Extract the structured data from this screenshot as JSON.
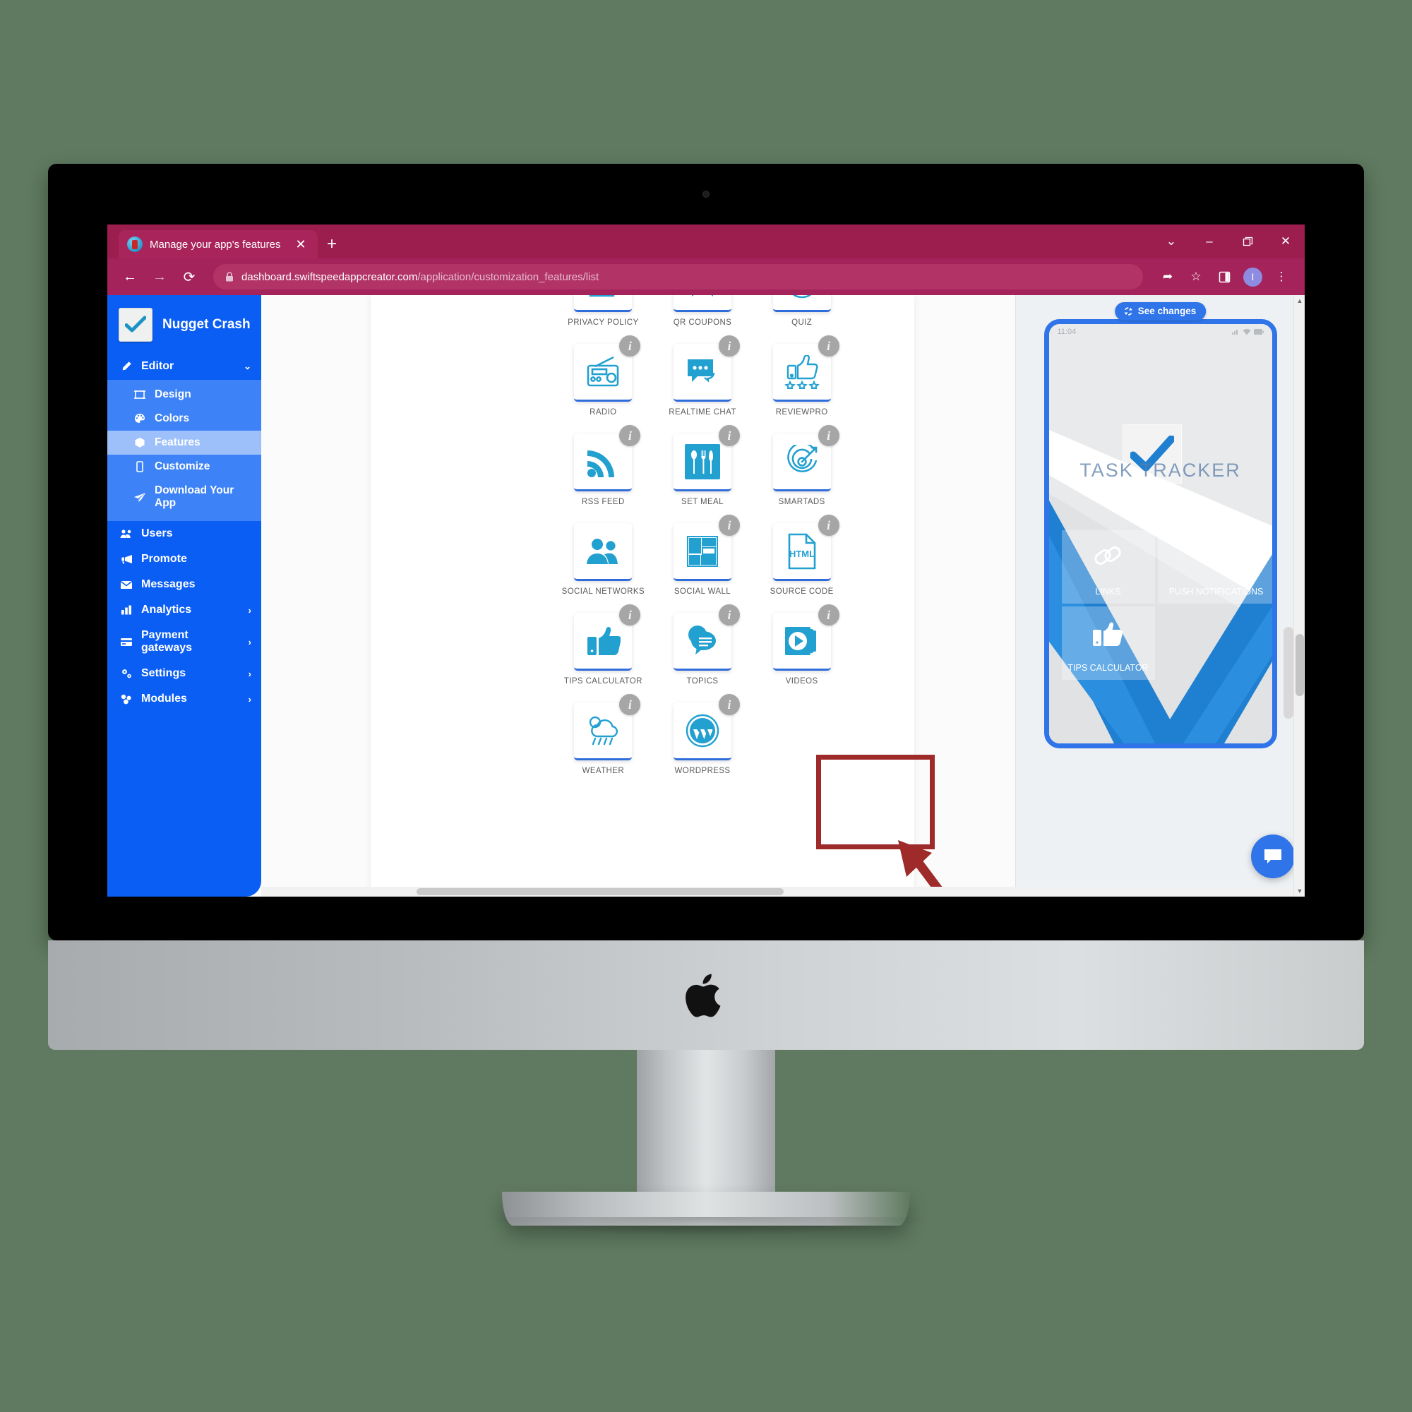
{
  "browser": {
    "tab": {
      "title": "Manage your app's features",
      "favicon_name": "app-favicon",
      "close_label": "✕",
      "new_tab_label": "+"
    },
    "window_controls": {
      "chevron": "⌄",
      "minimize": "–",
      "maximize": "❐",
      "close": "✕"
    },
    "toolbar": {
      "back": "←",
      "forward": "→",
      "reload": "⟳",
      "url_host": "dashboard.swiftspeedappcreator.com",
      "url_path": "/application/customization_features/list",
      "share": "➦",
      "favorite": "☆",
      "collections": "▣",
      "profile_initial": "I",
      "menu": "⋮"
    }
  },
  "sidebar": {
    "brand": {
      "name": "Nugget Crash",
      "logo_name": "checkmark-logo"
    },
    "editor_group": {
      "label": "Editor",
      "icon": "pencil-icon",
      "caret": "⌄"
    },
    "editor_items": [
      {
        "label": "Design",
        "icon": "design-icon",
        "active": false
      },
      {
        "label": "Colors",
        "icon": "palette-icon",
        "active": false
      },
      {
        "label": "Features",
        "icon": "cube-icon",
        "active": true
      },
      {
        "label": "Customize",
        "icon": "mobile-icon",
        "active": false
      },
      {
        "label": "Download Your App",
        "icon": "paper-plane-icon",
        "active": false
      }
    ],
    "items": [
      {
        "label": "Users",
        "icon": "users-icon",
        "chevron": ""
      },
      {
        "label": "Promote",
        "icon": "megaphone-icon",
        "chevron": ""
      },
      {
        "label": "Messages",
        "icon": "envelope-icon",
        "chevron": ""
      },
      {
        "label": "Analytics",
        "icon": "bar-chart-icon",
        "chevron": "›"
      },
      {
        "label": "Payment gateways",
        "icon": "credit-card-icon",
        "chevron": "›"
      },
      {
        "label": "Settings",
        "icon": "gears-icon",
        "chevron": "›"
      },
      {
        "label": "Modules",
        "icon": "modules-icon",
        "chevron": "›"
      }
    ]
  },
  "features": [
    {
      "label": "PRIVACY POLICY",
      "icon": "document-lines-icon",
      "info": false,
      "highlighted": false
    },
    {
      "label": "QR COUPONS",
      "icon": "bookmark-icon",
      "info": false,
      "highlighted": false
    },
    {
      "label": "QUIZ",
      "icon": "quiz-circle-icon",
      "info": false,
      "highlighted": false
    },
    {
      "label": "RADIO",
      "icon": "radio-icon",
      "info": true,
      "highlighted": false
    },
    {
      "label": "REALTIME CHAT",
      "icon": "chat-bubble-icon",
      "info": true,
      "highlighted": false
    },
    {
      "label": "REVIEWPRO",
      "icon": "thumbs-up-stars-icon",
      "info": true,
      "highlighted": false
    },
    {
      "label": "RSS FEED",
      "icon": "rss-icon",
      "info": true,
      "highlighted": false
    },
    {
      "label": "SET MEAL",
      "icon": "cutlery-icon",
      "info": true,
      "highlighted": false
    },
    {
      "label": "SMARTADS",
      "icon": "target-icon",
      "info": true,
      "highlighted": false
    },
    {
      "label": "SOCIAL NETWORKS",
      "icon": "two-people-icon",
      "info": false,
      "highlighted": false
    },
    {
      "label": "SOCIAL WALL",
      "icon": "layout-grid-icon",
      "info": true,
      "highlighted": false
    },
    {
      "label": "SOURCE CODE",
      "icon": "html-file-icon",
      "info": true,
      "highlighted": true
    },
    {
      "label": "TIPS CALCULATOR",
      "icon": "thumbs-up-phone-icon",
      "info": true,
      "highlighted": false
    },
    {
      "label": "TOPICS",
      "icon": "speech-bubbles-icon",
      "info": true,
      "highlighted": false
    },
    {
      "label": "VIDEOS",
      "icon": "video-play-icon",
      "info": true,
      "highlighted": false
    },
    {
      "label": "WEATHER",
      "icon": "cloud-rain-icon",
      "info": true,
      "highlighted": false
    },
    {
      "label": "WORDPRESS",
      "icon": "wordpress-icon",
      "info": true,
      "highlighted": false
    }
  ],
  "preview": {
    "see_changes_label": "See changes",
    "see_changes_icon": "refresh-icon",
    "phone": {
      "status_time": "11:04",
      "app_watermark": "TASK TRACKER",
      "tiles": [
        {
          "label": "LINKS",
          "icon": "link-icon"
        },
        {
          "label": "PUSH NOTIFICATIONS",
          "icon": "megaphone-icon"
        },
        {
          "label": "TIPS CALCULATOR",
          "icon": "thumbs-up-phone-icon"
        }
      ],
      "chat_fab_icon": "chat-bubble-icon"
    }
  },
  "colors": {
    "browser_chrome": "#a3235a",
    "sidebar_blue": "#0b5ef4",
    "sidebar_sub_blue": "#3d82f7",
    "sidebar_active": "#9dc0fb",
    "feature_icon_cyan": "#22a0d0",
    "tile_underline": "#2f6ddb",
    "highlight_red": "#9e2a2a",
    "preview_blue": "#2f74e8",
    "desktop_bg": "#5f7a60"
  }
}
